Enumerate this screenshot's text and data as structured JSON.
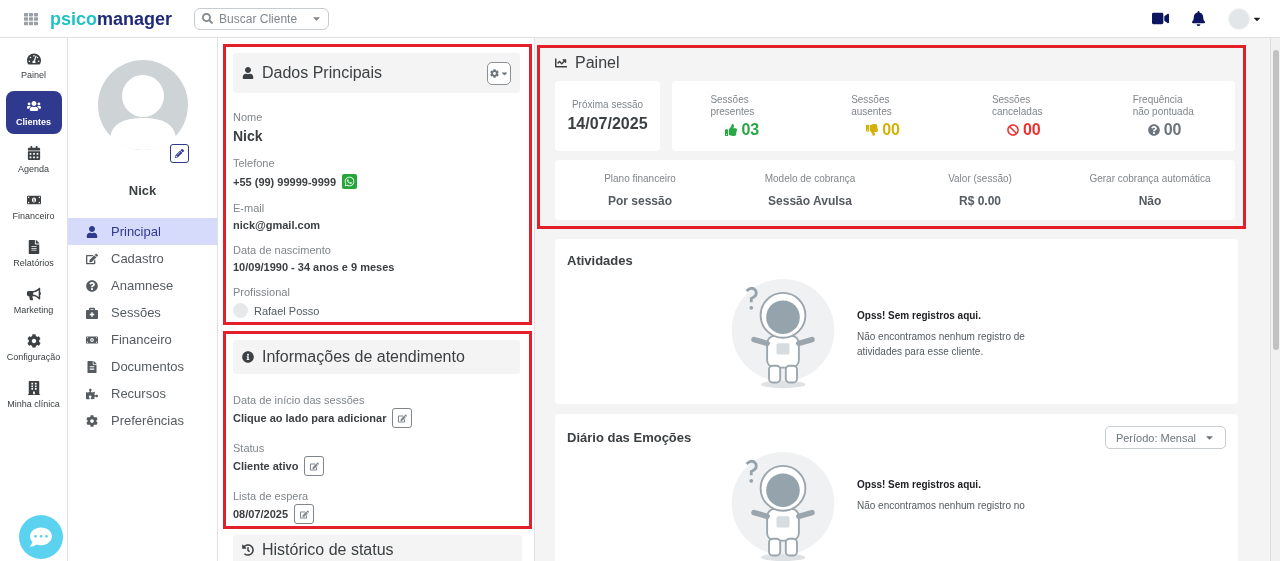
{
  "topbar": {
    "logo": [
      "psico",
      "manager"
    ],
    "search": {
      "placeholder": "Buscar Cliente"
    }
  },
  "nav": [
    {
      "label": "Painel",
      "selected": false
    },
    {
      "label": "Clientes",
      "selected": true
    },
    {
      "label": "Agenda",
      "selected": false
    },
    {
      "label": "Financeiro",
      "selected": false
    },
    {
      "label": "Relatórios",
      "selected": false
    },
    {
      "label": "Marketing",
      "selected": false
    },
    {
      "label": "Configuração",
      "selected": false
    },
    {
      "label": "Minha clínica",
      "selected": false
    }
  ],
  "profile": {
    "name": "Nick"
  },
  "menu": [
    {
      "label": "Principal",
      "selected": true
    },
    {
      "label": "Cadastro",
      "selected": false
    },
    {
      "label": "Anamnese",
      "selected": false
    },
    {
      "label": "Sessões",
      "selected": false
    },
    {
      "label": "Financeiro",
      "selected": false
    },
    {
      "label": "Documentos",
      "selected": false
    },
    {
      "label": "Recursos",
      "selected": false
    },
    {
      "label": "Preferências",
      "selected": false
    }
  ],
  "dados_principais": {
    "title": "Dados Principais",
    "fields": [
      {
        "label": "Nome",
        "value": "Nick",
        "kind": "name"
      },
      {
        "label": "Telefone",
        "value": "+55 (99) 99999-9999",
        "kind": "phone"
      },
      {
        "label": "E-mail",
        "value": "nick@gmail.com",
        "kind": "text"
      },
      {
        "label": "Data de nascimento",
        "value": "10/09/1990 - 34 anos e 9 meses",
        "kind": "text"
      },
      {
        "label": "Profissional",
        "value": "Rafael Posso",
        "kind": "person"
      }
    ]
  },
  "atendimento": {
    "title": "Informações de atendimento",
    "fields": [
      {
        "label": "Data de início das sessões",
        "value": "Clique ao lado para adicionar"
      },
      {
        "label": "Status",
        "value": "Cliente ativo"
      },
      {
        "label": "Lista de espera",
        "value": "08/07/2025"
      }
    ]
  },
  "historico": {
    "title": "Histórico de status"
  },
  "painel": {
    "title": "Painel",
    "next_session": {
      "label": "Próxima sessão",
      "value": "14/07/2025"
    },
    "stats": [
      {
        "label": "Sessões presentes",
        "value": "03",
        "kind": "present",
        "color": "#28a745"
      },
      {
        "label": "Sessões ausentes",
        "value": "00",
        "kind": "absent",
        "color": "#d4b106"
      },
      {
        "label": "Sessões canceladas",
        "value": "00",
        "kind": "cancelled",
        "color": "#f0302e"
      },
      {
        "label": "Frequência não pontuada",
        "value": "00",
        "kind": "unscored",
        "color": "#6c757d"
      }
    ],
    "finance": [
      {
        "label": "Plano financeiro",
        "value": "Por sessão"
      },
      {
        "label": "Modelo de cobrança",
        "value": "Sessão Avulsa"
      },
      {
        "label": "Valor (sessão)",
        "value": "R$ 0.00"
      },
      {
        "label": "Gerar cobrança automática",
        "value": "Não"
      }
    ]
  },
  "atividades": {
    "title": "Atividades",
    "empty_title": "Opss! Sem registros aqui.",
    "empty_text": "Não encontramos nenhum registro de atividades para esse cliente."
  },
  "diario": {
    "title": "Diário das Emoções",
    "period": "Período: Mensal",
    "empty_title": "Opss! Sem registros aqui.",
    "empty_text": "Não encontramos nenhum registro no"
  }
}
